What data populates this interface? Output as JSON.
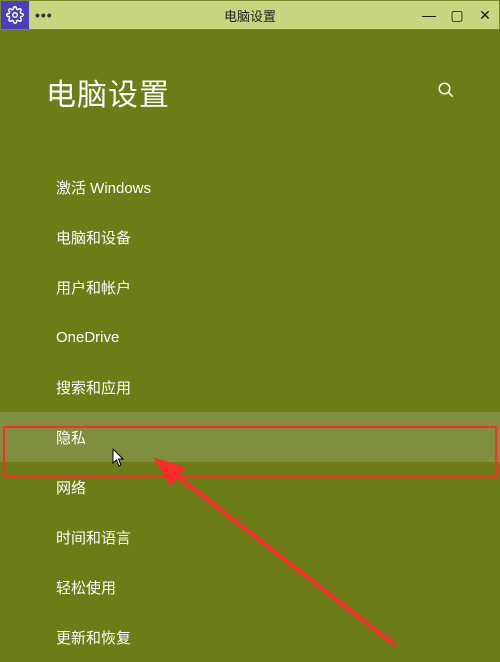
{
  "titlebar": {
    "title": "电脑设置",
    "menu_dots": "•••",
    "minimize": "—",
    "maximize": "▢",
    "close": "✕"
  },
  "header": {
    "title": "电脑设置"
  },
  "nav": {
    "items": [
      {
        "label": "激活 Windows"
      },
      {
        "label": "电脑和设备"
      },
      {
        "label": "用户和帐户"
      },
      {
        "label": "OneDrive"
      },
      {
        "label": "搜索和应用"
      },
      {
        "label": "隐私"
      },
      {
        "label": "网络"
      },
      {
        "label": "时间和语言"
      },
      {
        "label": "轻松使用"
      },
      {
        "label": "更新和恢复"
      }
    ],
    "highlighted_index": 5
  }
}
